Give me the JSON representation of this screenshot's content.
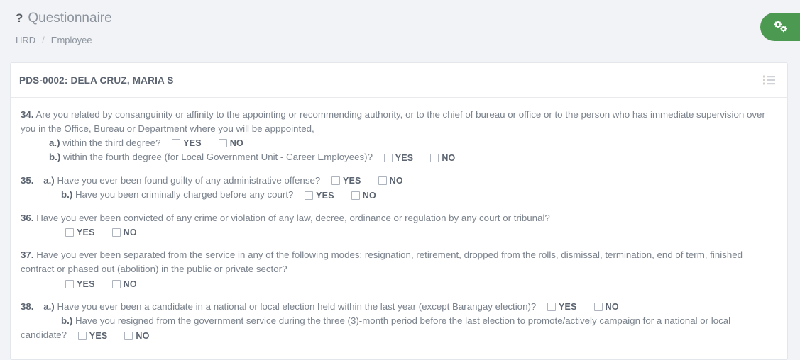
{
  "header": {
    "icon": "question-mark-icon",
    "title": "Questionnaire",
    "breadcrumb": {
      "root": "HRD",
      "separator": "/",
      "current": "Employee"
    },
    "settings_button_icon": "gears-icon",
    "accent_color": "#4c9a51"
  },
  "card": {
    "title": "PDS-0002: DELA CRUZ, MARIA S",
    "menu_icon": "list-icon"
  },
  "checkbox_labels": {
    "yes": "YES",
    "no": "NO"
  },
  "questions": [
    {
      "number": "34.",
      "text": "Are you related by consanguinity or affinity to the appointing or recommending authority, or to the chief of bureau or office or to the person who has immediate supervision over you in the Office, Bureau or Department where you will be apppointed,",
      "sub": [
        {
          "label": "a.)",
          "text": "within the third degree?"
        },
        {
          "label": "b.)",
          "text": "within the fourth degree (for Local Government Unit - Career Employees)?"
        }
      ]
    },
    {
      "number": "35.",
      "text": "",
      "sub": [
        {
          "label": "a.)",
          "text": "Have you ever been found guilty of any administrative offense?"
        },
        {
          "label": "b.)",
          "text": "Have you been criminally charged before any court?"
        }
      ]
    },
    {
      "number": "36.",
      "text": "Have you ever been convicted of any crime or violation of any law, decree, ordinance or regulation by any court or tribunal?",
      "sub": []
    },
    {
      "number": "37.",
      "text": "Have you ever been separated from the service in any of the following modes: resignation, retirement, dropped from the rolls, dismissal, termination, end of term, finished contract or phased out (abolition) in the public or private sector?",
      "sub": []
    },
    {
      "number": "38.",
      "text": "",
      "sub": [
        {
          "label": "a.)",
          "text": "Have you ever been a candidate in a national or local election held within the last year (except Barangay election)?"
        },
        {
          "label": "b.)",
          "text": "Have you resigned from the government service during the three (3)-month period before the last election to promote/actively campaign for a national or local candidate?"
        }
      ]
    }
  ]
}
